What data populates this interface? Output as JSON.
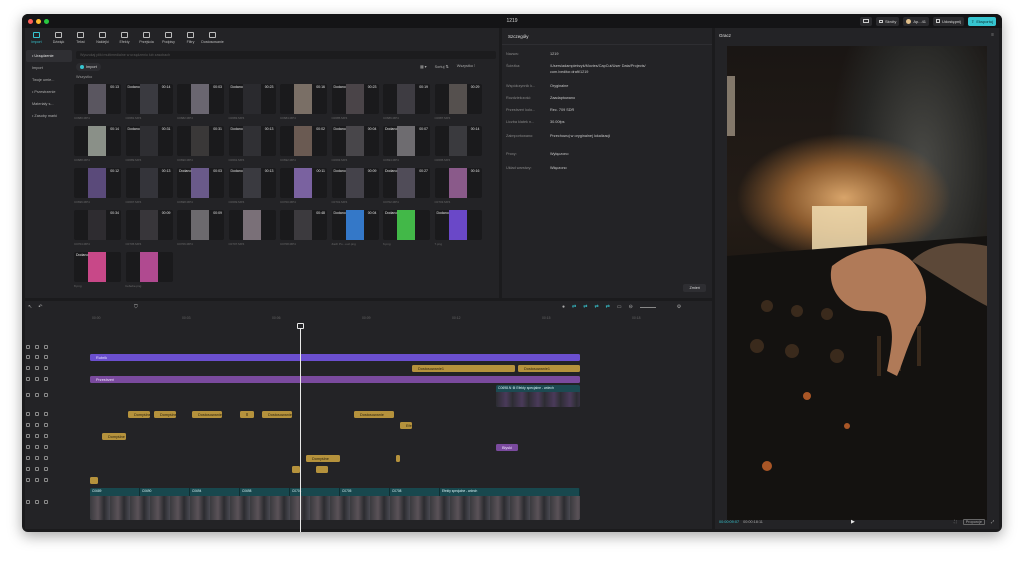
{
  "window": {
    "title": "1219",
    "traffic": [
      "#ff5f57",
      "#febc2e",
      "#28c840"
    ]
  },
  "titlebar": {
    "skroty": "Skróty",
    "user": "Ap...41",
    "udostepnij": "Udostępnij",
    "eksportuj": "Eksportuj"
  },
  "toolbar": [
    {
      "label": "Import",
      "active": true
    },
    {
      "label": "Dźwięk",
      "active": false
    },
    {
      "label": "Tekst",
      "active": false
    },
    {
      "label": "Naklejki",
      "active": false
    },
    {
      "label": "Efekty",
      "active": false
    },
    {
      "label": "Przejścia",
      "active": false
    },
    {
      "label": "Podpisy",
      "active": false
    },
    {
      "label": "Filtry",
      "active": false
    },
    {
      "label": "Dostosowanie",
      "active": false
    }
  ],
  "sidebar": [
    {
      "label": "• Urządzenie",
      "sel": true
    },
    {
      "label": "Import",
      "sel": false
    },
    {
      "label": "Twoje umie...",
      "sel": false
    },
    {
      "label": "• Przestrzenie",
      "sel": false
    },
    {
      "label": "Materiały s...",
      "sel": false
    },
    {
      "label": "• Zasoby marki",
      "sel": false
    }
  ],
  "media": {
    "import_label": "Import",
    "section_label": "Wszystko",
    "sort_label": "Sortuj",
    "filter_label": "Wszystko",
    "search_placeholder": "Wyszukaj pliki multimedialne w urządzeniu lub zasobach",
    "items": [
      {
        "dur": "00:13",
        "tag": "",
        "label": "C0680.MP4",
        "color": "#5a5660"
      },
      {
        "dur": "00:14",
        "tag": "Dodano",
        "label": "C0681.MP4",
        "color": "#3a3a40"
      },
      {
        "dur": "00:03",
        "tag": "",
        "label": "C0682.MP4",
        "color": "#6a6670"
      },
      {
        "dur": "00:23",
        "tag": "Dodano",
        "label": "C0683.MP4",
        "color": "#2a2a2e"
      },
      {
        "dur": "00:16",
        "tag": "",
        "label": "C0684.MP4",
        "color": "#7a6f66"
      },
      {
        "dur": "00:23",
        "tag": "Dodano",
        "label": "C0685.MP4",
        "color": "#4a4448"
      },
      {
        "dur": "00:19",
        "tag": "",
        "label": "C0686.MP4",
        "color": "#3e3c42"
      },
      {
        "dur": "00:29",
        "tag": "",
        "label": "C0687.MP4",
        "color": "#55504e"
      },
      {
        "dur": "00:14",
        "tag": "",
        "label": "C0688.MP4",
        "color": "#8a9088"
      },
      {
        "dur": "00:31",
        "tag": "Dodano",
        "label": "C0689.MP4",
        "color": "#2e2e32"
      },
      {
        "dur": "00:31",
        "tag": "",
        "label": "C0690.MP4",
        "color": "#3a3838"
      },
      {
        "dur": "00:13",
        "tag": "Dodano",
        "label": "C0691.MP4",
        "color": "#303034"
      },
      {
        "dur": "00:02",
        "tag": "",
        "label": "C0692.MP4",
        "color": "#6a5a52"
      },
      {
        "dur": "00:04",
        "tag": "Dodano",
        "label": "C0693.MP4",
        "color": "#48464a"
      },
      {
        "dur": "00:07",
        "tag": "Dodano",
        "label": "C0694.MP4",
        "color": "#6e6c70"
      },
      {
        "dur": "00:14",
        "tag": "",
        "label": "C0695.MP4",
        "color": "#3a3a3e"
      },
      {
        "dur": "00:12",
        "tag": "",
        "label": "C0696.MP4",
        "color": "#5a4a7a"
      },
      {
        "dur": "00:13",
        "tag": "",
        "label": "C0697.MP4",
        "color": "#34343a"
      },
      {
        "dur": "00:03",
        "tag": "Dodano",
        "label": "C0698.MP4",
        "color": "#6a5a8a"
      },
      {
        "dur": "00:13",
        "tag": "Dodano",
        "label": "C0699.MP4",
        "color": "#3a3a40"
      },
      {
        "dur": "00:11",
        "tag": "",
        "label": "C0700.MP4",
        "color": "#7a62a0"
      },
      {
        "dur": "00:09",
        "tag": "Dodano",
        "label": "C0701.MP4",
        "color": "#44424a"
      },
      {
        "dur": "00:27",
        "tag": "Dodano",
        "label": "C0702.MP4",
        "color": "#504c58"
      },
      {
        "dur": "00:16",
        "tag": "",
        "label": "C0703.MP4",
        "color": "#8a5a8a"
      },
      {
        "dur": "00:34",
        "tag": "",
        "label": "C0704.MP4",
        "color": "#2e2c30"
      },
      {
        "dur": "00:09",
        "tag": "",
        "label": "C0705.MP4",
        "color": "#38363a"
      },
      {
        "dur": "00:09",
        "tag": "",
        "label": "C0706.MP4",
        "color": "#6c6a6e"
      },
      {
        "dur": "",
        "tag": "",
        "label": "C0707.MP4",
        "color": "#7a7078"
      },
      {
        "dur": "00:48",
        "tag": "",
        "label": "C0708.MP4",
        "color": "#3c3a3e"
      },
      {
        "dur": "00:04",
        "tag": "Dodano",
        "label": "Zach Po...ouz.png",
        "color": "#3478c8"
      },
      {
        "dur": "",
        "tag": "Dodano",
        "label": "6.png",
        "color": "#42b848"
      },
      {
        "dur": "",
        "tag": "Dodano",
        "label": "7.png",
        "color": "#6a48c8"
      },
      {
        "dur": "",
        "tag": "Dodano",
        "label": "8.png",
        "color": "#c84888"
      },
      {
        "dur": "",
        "tag": "",
        "label": "bebebe.png",
        "color": "#b04a90"
      }
    ]
  },
  "details": {
    "header": "Szczegóły",
    "rows": [
      {
        "k": "Nazwa:",
        "v": "1219"
      },
      {
        "k": "Ścieżka:",
        "v": "/Users/adampietrzyk/Movies/CapCut/User Data/Projects/"
      },
      {
        "k": "",
        "v": "com.lveditor.draft/1219"
      },
      {
        "k": "Współczynnik k...",
        "v": "Oryginalne"
      },
      {
        "k": "Rozdzielczość:",
        "v": "Zaadaptowano"
      },
      {
        "k": "Przestrzeń kolo...",
        "v": "Rec. 709 SDR"
      },
      {
        "k": "Liczba klatek n...",
        "v": "30.00fps"
      },
      {
        "k": "Zaimportowano:",
        "v": "Przechowuj w oryginalnej lokalizacji"
      },
      {
        "k": "Proxy:",
        "v": "Wyłączono"
      },
      {
        "k": "Układ warstwy:",
        "v": "Włączono"
      }
    ],
    "edit_button": "Zmień"
  },
  "player": {
    "header": "Gracz",
    "time_current": "00:00:09:07",
    "time_total": "00:00:18:11",
    "ratio_label": "Proporcje"
  },
  "timeline": {
    "ruler": [
      "00:00",
      "00:03",
      "00:06",
      "00:09",
      "00:12",
      "00:15",
      "00:18"
    ],
    "tracks": [
      {
        "label": "Rubrik",
        "style": "purple"
      },
      {
        "label": "Przestrzeń",
        "style": "violet"
      },
      {
        "label": "Dostosowanie1",
        "style": "gold"
      },
      {
        "label": "Dostosowanie1",
        "style": "gold"
      },
      {
        "label": "Domyślne",
        "style": "gold"
      },
      {
        "label": "Domyślne",
        "style": "gold"
      },
      {
        "label": "Dostosowanie",
        "style": "gold"
      },
      {
        "label": "Ⅱ",
        "style": "gold"
      },
      {
        "label": "Domyślne",
        "style": "gold"
      },
      {
        "label": "Domyślne",
        "style": "gold"
      },
      {
        "label": "Dostosowanie",
        "style": "gold"
      },
      {
        "label": "Błyski",
        "style": "violet"
      },
      {
        "label": "Dostosowanie",
        "style": "gold"
      },
      {
        "label": "Efekty specjalne - wdech",
        "style": "gold"
      }
    ],
    "main_clip_labels": [
      "C0689",
      "C0690",
      "C0694",
      "C0698",
      "C0701",
      "C0705",
      "C0708",
      "Efekty specjalne - wdech"
    ],
    "overlay_label": "C0698.N",
    "overlay_label2": "Efekty specjalne - wdech"
  }
}
